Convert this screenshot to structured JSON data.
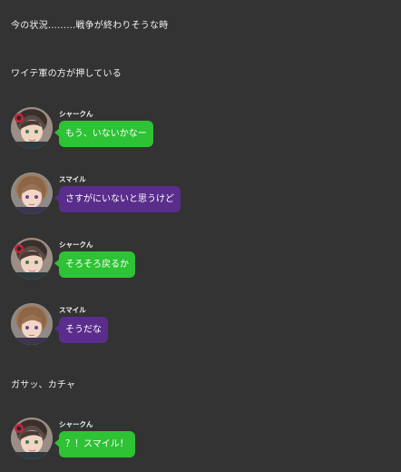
{
  "narration": [
    "今の状況………戦争が終わりそうな時",
    "ワイテ軍の方が押している",
    "ガサッ、カチャ"
  ],
  "characters": {
    "shark": {
      "name": "シャークん",
      "bubble_color": "#2ec235",
      "avatar_icon": "shark-avatar-icon"
    },
    "smile": {
      "name": "スマイル",
      "bubble_color": "#5a2d8c",
      "avatar_icon": "smile-avatar-icon"
    }
  },
  "messages": [
    {
      "sender": "シャークん",
      "text": "もう、いないかなー"
    },
    {
      "sender": "スマイル",
      "text": "さすがにいないと思うけど"
    },
    {
      "sender": "シャークん",
      "text": "そろそろ戻るか"
    },
    {
      "sender": "スマイル",
      "text": "そうだな"
    },
    {
      "sender": "シャークん",
      "text": "？！スマイル！"
    }
  ]
}
